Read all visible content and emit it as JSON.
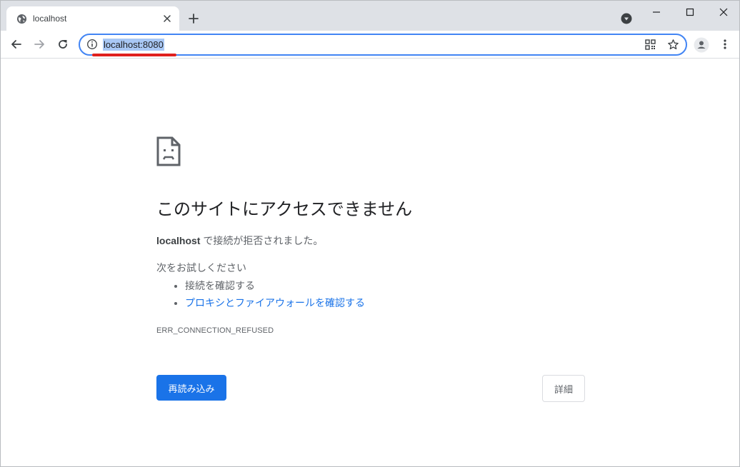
{
  "tab": {
    "title": "localhost",
    "favicon": "globe-icon"
  },
  "toolbar": {
    "url": "localhost:8080",
    "info_icon": "info-icon",
    "qr_icon": "qr-code-icon",
    "star_icon": "star-icon",
    "profile_icon": "profile-icon",
    "menu_icon": "kebab-menu-icon"
  },
  "error_page": {
    "heading": "このサイトにアクセスできません",
    "host": "localhost",
    "message": " で接続が拒否されました。",
    "try_heading": "次をお試しください",
    "suggestions": [
      "接続を確認する",
      "プロキシとファイアウォールを確認する"
    ],
    "error_code": "ERR_CONNECTION_REFUSED",
    "reload_label": "再読み込み",
    "details_label": "詳細"
  },
  "colors": {
    "accent": "#1a73e8",
    "omnibox_border": "#4285f4",
    "url_highlight": "#a9c8f5",
    "annotation_underline": "#e0201e",
    "tabstrip": "#dee1e6"
  }
}
